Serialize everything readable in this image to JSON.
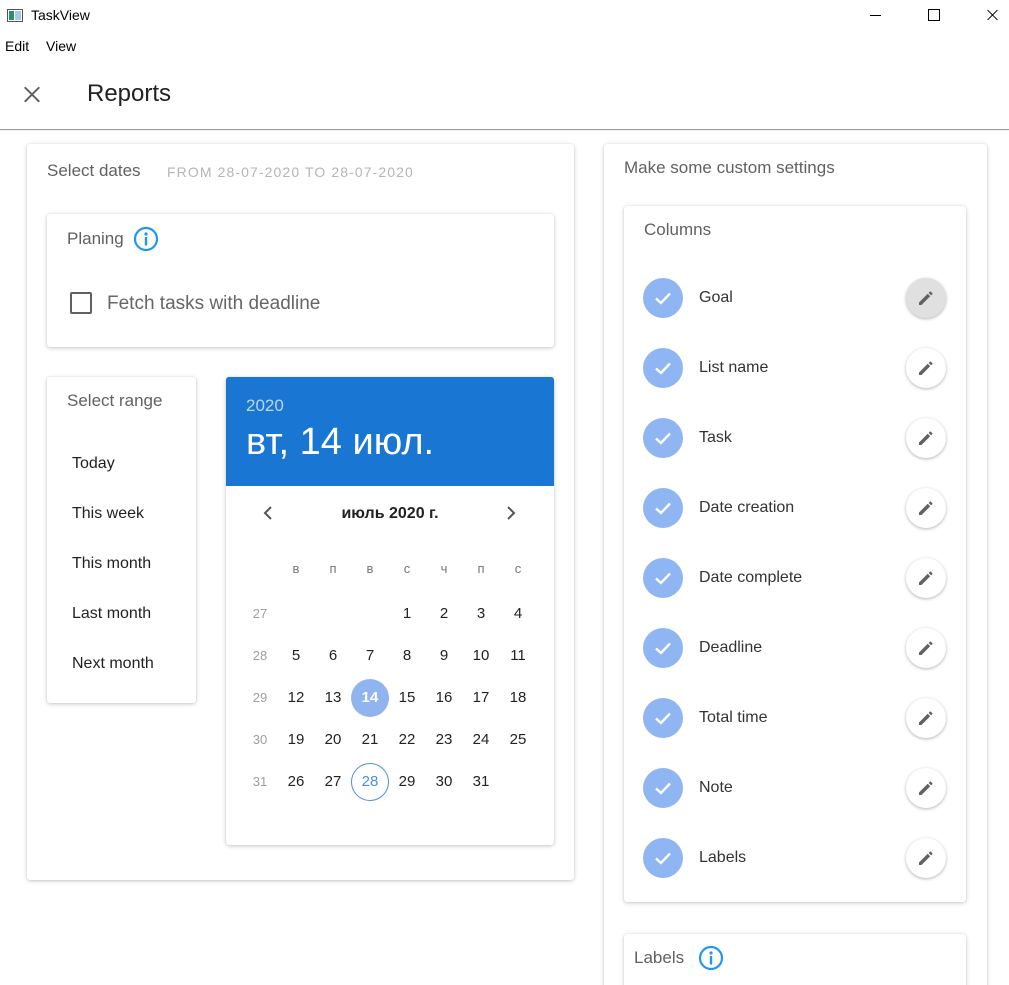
{
  "window": {
    "title": "TaskView"
  },
  "menu": {
    "edit": "Edit",
    "view": "View"
  },
  "header": {
    "title": "Reports"
  },
  "dates": {
    "label": "Select dates",
    "range_text": "FROM 28-07-2020 TO 28-07-2020"
  },
  "planing": {
    "title": "Planing",
    "checkbox_label": "Fetch tasks with deadline",
    "checked": false
  },
  "range": {
    "title": "Select range",
    "items": [
      "Today",
      "This week",
      "This month",
      "Last month",
      "Next month"
    ]
  },
  "calendar": {
    "year": "2020",
    "selected_date": "вт, 14 июл.",
    "month_label": "июль 2020 г.",
    "weekdays": [
      "в",
      "п",
      "в",
      "с",
      "ч",
      "п",
      "с"
    ],
    "weeks": [
      {
        "num": "27",
        "days": [
          "",
          "",
          "",
          "1",
          "2",
          "3",
          "4"
        ]
      },
      {
        "num": "28",
        "days": [
          "5",
          "6",
          "7",
          "8",
          "9",
          "10",
          "11"
        ]
      },
      {
        "num": "29",
        "days": [
          "12",
          "13",
          "14",
          "15",
          "16",
          "17",
          "18"
        ]
      },
      {
        "num": "30",
        "days": [
          "19",
          "20",
          "21",
          "22",
          "23",
          "24",
          "25"
        ]
      },
      {
        "num": "31",
        "days": [
          "26",
          "27",
          "28",
          "29",
          "30",
          "31",
          ""
        ]
      }
    ],
    "selected_day": "14",
    "today_day": "28",
    "accent_color": "#1976d2"
  },
  "settings": {
    "title": "Make some custom settings",
    "columns_title": "Columns",
    "columns": [
      "Goal",
      "List name",
      "Task",
      "Date creation",
      "Date complete",
      "Deadline",
      "Total time",
      "Note",
      "Labels"
    ],
    "labels_title": "Labels"
  }
}
